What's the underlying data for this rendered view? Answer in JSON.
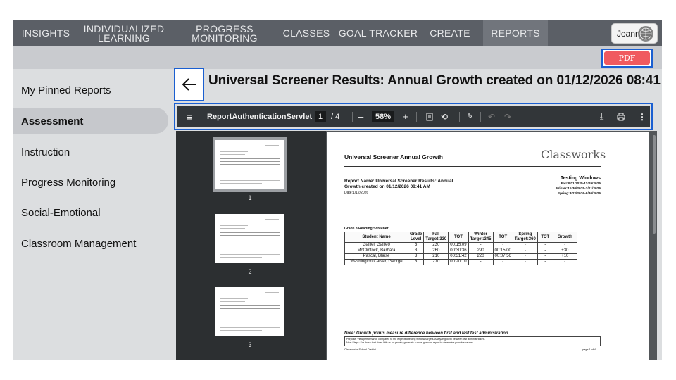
{
  "nav": {
    "items": [
      {
        "lines": [
          "INSIGHTS"
        ]
      },
      {
        "lines": [
          "INDIVIDUALIZED",
          "LEARNING"
        ]
      },
      {
        "lines": [
          "PROGRESS",
          "MONITORING"
        ]
      },
      {
        "lines": [
          "CLASSES"
        ]
      },
      {
        "lines": [
          "GOAL TRACKER"
        ]
      },
      {
        "lines": [
          "CREATE"
        ]
      },
      {
        "lines": [
          "REPORTS"
        ]
      }
    ],
    "active": "REPORTS",
    "user": "Joann"
  },
  "pdf_label": "PDF",
  "sidebar": {
    "items": [
      {
        "label": "My Pinned Reports"
      },
      {
        "label": "Assessment"
      },
      {
        "label": "Instruction"
      },
      {
        "label": "Progress Monitoring"
      },
      {
        "label": "Social-Emotional"
      },
      {
        "label": "Classroom Management"
      }
    ],
    "selected": "Assessment"
  },
  "back_icon": "arrow-left-icon",
  "title": "Universal Screener Results: Annual Growth created on 01/12/2026 08:41 AM",
  "viewer": {
    "doc_name": "ReportAuthenticationServlet",
    "page_current": "1",
    "page_total": "/ 4",
    "zoom": "58%",
    "minus": "–",
    "plus": "+",
    "thumb_numbers": [
      "1",
      "2",
      "3"
    ]
  },
  "report": {
    "heading": "Universal Screener Annual Growth",
    "logo": "Classworks",
    "name_line1": "Report Name: Universal Screener Results: Annual",
    "name_line2": "Growth created on 01/12/2026 08:41 AM",
    "date": "Date:1/12/2026",
    "windows_title": "Testing Windows",
    "windows": [
      "Fall:8/01/2025-11/29/2025",
      "Winter:11/30/2025-3/21/2026",
      "Spring:3/22/2026-6/30/2026"
    ],
    "section": "Grade 3 Reading Screener",
    "columns": [
      "Student Name",
      "Grade Level",
      "Fall Target:330",
      "TOT",
      "Winter Target:345",
      "TOT",
      "Spring Target:360",
      "TOT",
      "Growth"
    ],
    "rows": [
      [
        "Galilei, Galileo",
        "3",
        "230",
        "00:15:09",
        "-",
        "-",
        "-",
        "-",
        "-"
      ],
      [
        "McClintock, Barbara",
        "3",
        "260",
        "00:30:36",
        "290",
        "00:15:00",
        "-",
        "-",
        "+30"
      ],
      [
        "Pascal, Blaise",
        "3",
        "210",
        "00:31:42",
        "220",
        "00:07:56",
        "-",
        "-",
        "+10"
      ],
      [
        "Washington Carver, George",
        "3",
        "270",
        "00:20:10",
        "-",
        "-",
        "-",
        "-",
        "-"
      ]
    ],
    "note": "Note: Growth points measure difference between first and last test administration.",
    "purpose": "Purpose: View performance compared to the expected testing window targets. Analyze growth between test administrations.",
    "next_steps": "Next Steps: For those that show little or no growth, generate a more granular report to determine possible causes.",
    "district": "Classworks School District",
    "page_label": "page 1 of 4"
  }
}
